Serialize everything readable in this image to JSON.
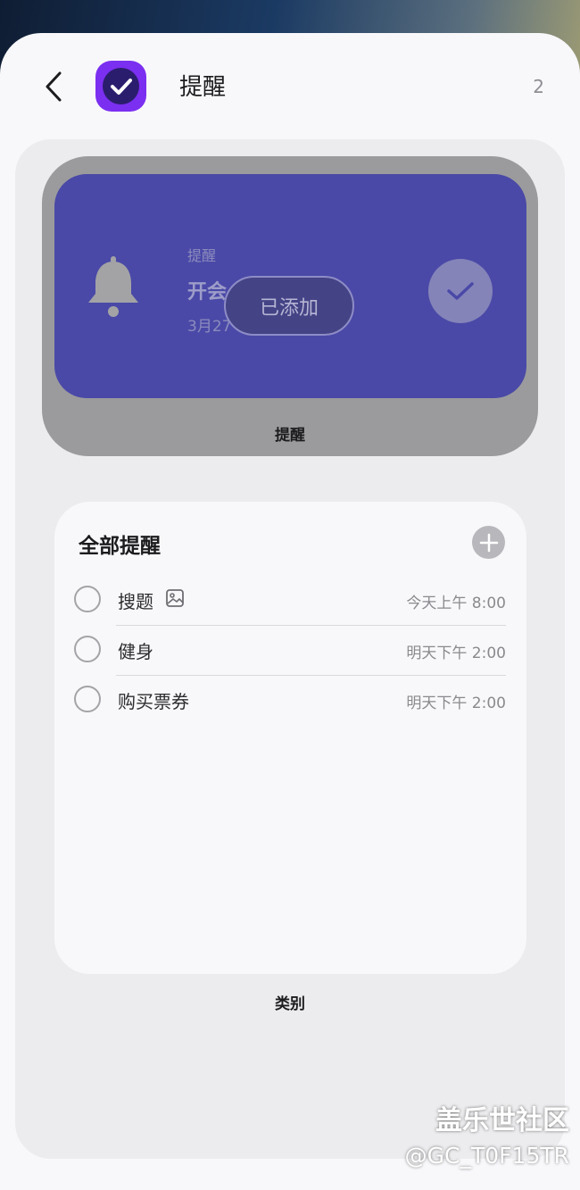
{
  "header": {
    "title": "提醒",
    "page_count": "2",
    "app_icon": "check-circle-icon",
    "back_icon": "chevron-left-icon"
  },
  "widget": {
    "small_label": "提醒",
    "title": "开会",
    "date": "3月27",
    "toast": "已添加",
    "caption": "提醒",
    "bg_color": "#4a49a7"
  },
  "list": {
    "title": "全部提醒",
    "items": [
      {
        "label": "搜题",
        "time": "今天上午 8:00",
        "has_image": true
      },
      {
        "label": "健身",
        "time": "明天下午 2:00"
      },
      {
        "label": "购买票券",
        "time": "明天下午 2:00"
      }
    ],
    "caption": "类别"
  },
  "watermark": {
    "line1": "盖乐世社区",
    "line2": "@GC_T0F15TR"
  },
  "colors": {
    "accent": "#7b2ff0",
    "panel": "#ececee"
  }
}
